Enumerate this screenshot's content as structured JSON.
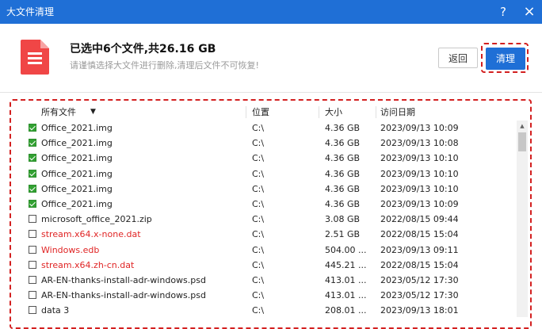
{
  "window": {
    "title": "大文件清理",
    "help_icon": "?",
    "close_icon": "×"
  },
  "header": {
    "headline": "已选中6个文件,共26.16 GB",
    "subline": "请谨慎选择大文件进行删除,清理后文件不可恢复!",
    "back_label": "返回",
    "clean_label": "清理",
    "icon": "document-icon",
    "accent_color": "#1f6fd6",
    "icon_color": "#f04646"
  },
  "list": {
    "columns": {
      "name": "所有文件",
      "location": "位置",
      "size": "大小",
      "date": "访问日期"
    },
    "rows": [
      {
        "checked": true,
        "warn": false,
        "name": "Office_2021.img",
        "location": "C:\\",
        "size": "4.36 GB",
        "date": "2023/09/13 10:09"
      },
      {
        "checked": true,
        "warn": false,
        "name": "Office_2021.img",
        "location": "C:\\",
        "size": "4.36 GB",
        "date": "2023/09/13 10:08"
      },
      {
        "checked": true,
        "warn": false,
        "name": "Office_2021.img",
        "location": "C:\\",
        "size": "4.36 GB",
        "date": "2023/09/13 10:10"
      },
      {
        "checked": true,
        "warn": false,
        "name": "Office_2021.img",
        "location": "C:\\",
        "size": "4.36 GB",
        "date": "2023/09/13 10:10"
      },
      {
        "checked": true,
        "warn": false,
        "name": "Office_2021.img",
        "location": "C:\\",
        "size": "4.36 GB",
        "date": "2023/09/13 10:10"
      },
      {
        "checked": true,
        "warn": false,
        "name": "Office_2021.img",
        "location": "C:\\",
        "size": "4.36 GB",
        "date": "2023/09/13 10:09"
      },
      {
        "checked": false,
        "warn": false,
        "name": "microsoft_office_2021.zip",
        "location": "C:\\",
        "size": "3.08 GB",
        "date": "2022/08/15 09:44"
      },
      {
        "checked": false,
        "warn": true,
        "name": "stream.x64.x-none.dat",
        "location": "C:\\",
        "size": "2.51 GB",
        "date": "2022/08/15 15:04"
      },
      {
        "checked": false,
        "warn": true,
        "name": "Windows.edb",
        "location": "C:\\",
        "size": "504.00 ...",
        "date": "2023/09/13 09:11"
      },
      {
        "checked": false,
        "warn": true,
        "name": "stream.x64.zh-cn.dat",
        "location": "C:\\",
        "size": "445.21 ...",
        "date": "2022/08/15 15:04"
      },
      {
        "checked": false,
        "warn": false,
        "name": "AR-EN-thanks-install-adr-windows.psd",
        "location": "C:\\",
        "size": "413.01 ...",
        "date": "2023/05/12 17:30"
      },
      {
        "checked": false,
        "warn": false,
        "name": "AR-EN-thanks-install-adr-windows.psd",
        "location": "C:\\",
        "size": "413.01 ...",
        "date": "2023/05/12 17:30"
      },
      {
        "checked": false,
        "warn": false,
        "name": "data 3",
        "location": "C:\\",
        "size": "208.01 ...",
        "date": "2023/09/13 18:01"
      }
    ]
  }
}
